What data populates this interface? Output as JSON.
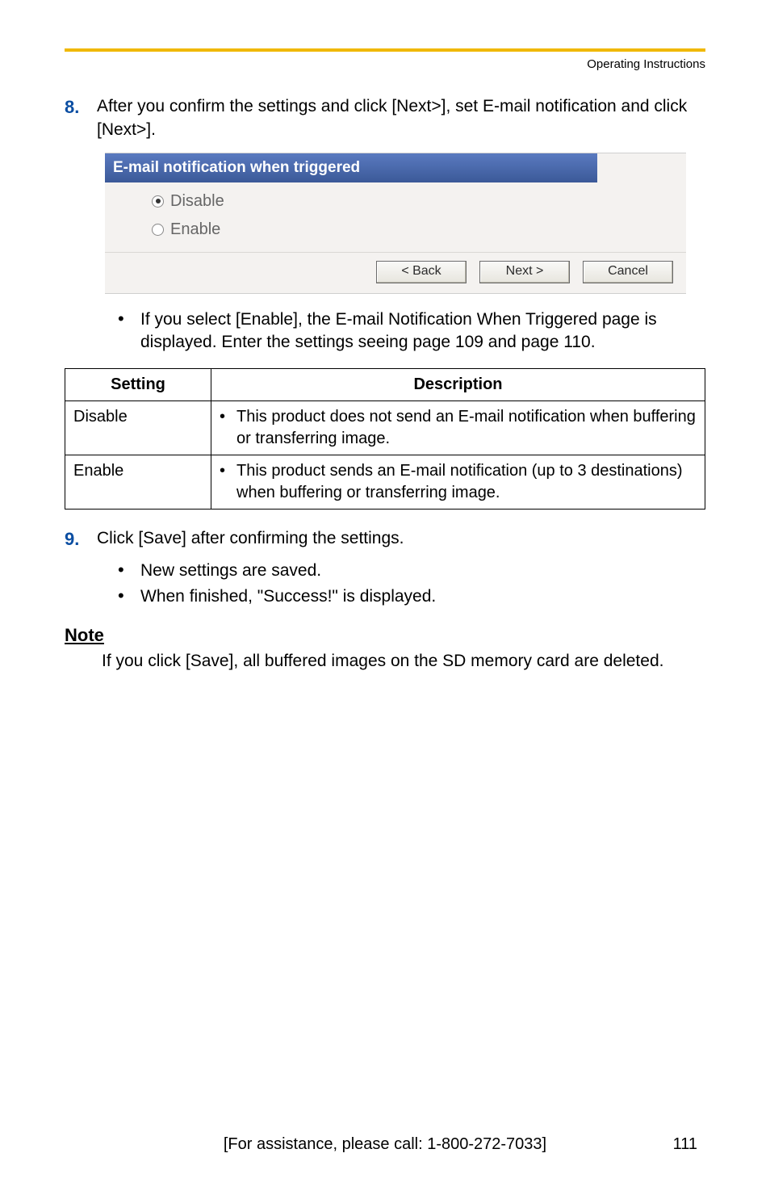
{
  "header": {
    "running_title": "Operating Instructions"
  },
  "step8": {
    "num": "8.",
    "text": "After you confirm the settings and click [Next>], set E-mail notification and click [Next>]."
  },
  "screenshot": {
    "panel_title": "E-mail notification when triggered",
    "option_disable": "Disable",
    "option_enable": "Enable",
    "btn_back": "< Back",
    "btn_next": "Next >",
    "btn_cancel": "Cancel"
  },
  "after_ss_bullet": "If you select [Enable], the E-mail Notification When Triggered page is displayed. Enter the settings seeing page 109 and page 110.",
  "table": {
    "col_setting": "Setting",
    "col_description": "Description",
    "rows": [
      {
        "setting": "Disable",
        "desc": "This product does not send an E-mail notification when buffering or transferring image."
      },
      {
        "setting": "Enable",
        "desc": "This product sends an E-mail notification (up to 3 destinations) when buffering or transferring image."
      }
    ]
  },
  "step9": {
    "num": "9.",
    "text": "Click [Save] after confirming the settings.",
    "sub1": "New settings are saved.",
    "sub2": "When finished, \"Success!\" is displayed."
  },
  "note": {
    "heading": "Note",
    "body": "If you click [Save], all buffered images on the SD memory card are deleted."
  },
  "footer": {
    "assist": "[For assistance, please call: 1-800-272-7033]",
    "page": "111"
  }
}
